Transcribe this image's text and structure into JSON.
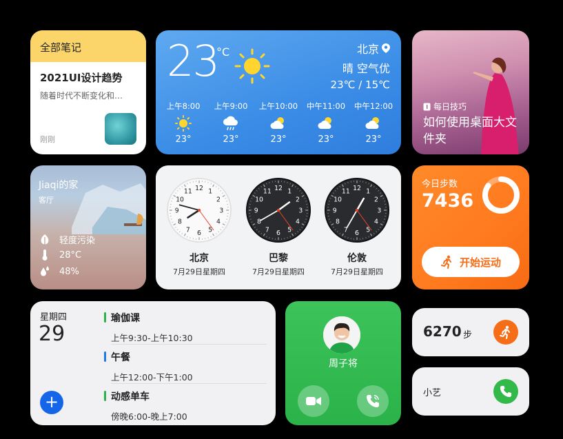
{
  "notes": {
    "header": "全部笔记",
    "title": "2021UI设计趋势",
    "snippet": "随着时代不断变化和…",
    "time": "刚刚"
  },
  "weather": {
    "temp": "23",
    "unit": "°C",
    "city": "北京",
    "condition": "晴  空气优",
    "range": "23℃ / 15℃",
    "hourly": [
      {
        "time": "上午8:00",
        "icon": "sun-icon",
        "temp": "23°"
      },
      {
        "time": "上午9:00",
        "icon": "cloud-rain-icon",
        "temp": "23°"
      },
      {
        "time": "上午10:00",
        "icon": "partly-cloudy-icon",
        "temp": "23°"
      },
      {
        "time": "中午11:00",
        "icon": "partly-cloudy-icon",
        "temp": "23°"
      },
      {
        "time": "中午12:00",
        "icon": "partly-cloudy-icon",
        "temp": "23°"
      }
    ]
  },
  "tips": {
    "label": "每日技巧",
    "title": "如何使用桌面大文件夹"
  },
  "home": {
    "name": "Jiaqi的家",
    "room": "客厅",
    "air": "轻度污染",
    "temperature": "28°C",
    "humidity": "48%"
  },
  "clocks": [
    {
      "city": "北京",
      "date": "7月29日星期四",
      "theme": "light"
    },
    {
      "city": "巴黎",
      "date": "7月29日星期四",
      "theme": "dark"
    },
    {
      "city": "伦敦",
      "date": "7月29日星期四",
      "theme": "dark"
    }
  ],
  "steps": {
    "label": "今日步数",
    "count": "7436",
    "button": "开始运动",
    "progress": 0.85,
    "accent": "#ff7a1e"
  },
  "calendar": {
    "weekday": "星期四",
    "day": "29",
    "add_label": "+",
    "events": [
      {
        "title": "瑜伽课",
        "time": "上午9:30-上午10:30",
        "color": "#2bb34a"
      },
      {
        "title": "午餐",
        "time": "上午12:00-下午1:00",
        "color": "#1f7ae8"
      },
      {
        "title": "动感单车",
        "time": "傍晚6:00-晚上7:00",
        "color": "#2bb34a"
      }
    ]
  },
  "contact": {
    "name": "周子将"
  },
  "small_steps": {
    "value": "6270",
    "unit": "步"
  },
  "xiaoyi": {
    "name": "小艺"
  }
}
